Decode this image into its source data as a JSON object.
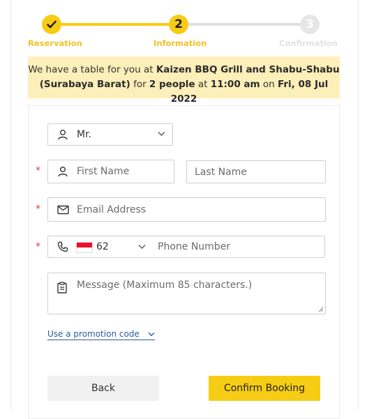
{
  "stepper": {
    "steps": [
      {
        "label": "Reservation",
        "marker": "",
        "state": "done"
      },
      {
        "label": "Information",
        "marker": "2",
        "state": "current"
      },
      {
        "label": "Confirmation",
        "marker": "3",
        "state": "upcoming"
      }
    ]
  },
  "banner": {
    "prefix": "We have a table for you at",
    "restaurant": "Kaizen BBQ Grill and Shabu-Shabu (Surabaya Barat)",
    "for_word": "for",
    "party": "2 people",
    "at_word": "at",
    "time": "11:00 am",
    "on_word": "on",
    "date": "Fri, 08 Jul 2022"
  },
  "form": {
    "required_mark": "*",
    "salutation": {
      "value": "Mr."
    },
    "first_name": {
      "placeholder": "First Name"
    },
    "last_name": {
      "placeholder": "Last Name"
    },
    "email": {
      "placeholder": "Email Address"
    },
    "phone": {
      "country_code": "62",
      "placeholder": "Phone Number"
    },
    "message": {
      "placeholder": "Message (Maximum 85 characters.)"
    },
    "promo_link": "Use a promotion code"
  },
  "actions": {
    "back_label": "Back",
    "confirm_label": "Confirm Booking"
  },
  "colors": {
    "accent": "#f7cc15",
    "banner_bg": "#fcefb9",
    "required": "#e03a3a",
    "link": "#2b5b9e"
  },
  "icons": [
    "check-icon",
    "user-icon",
    "chevron-down-icon",
    "mail-icon",
    "phone-icon",
    "indonesia-flag-icon",
    "clipboard-icon",
    "resize-grip-icon"
  ]
}
